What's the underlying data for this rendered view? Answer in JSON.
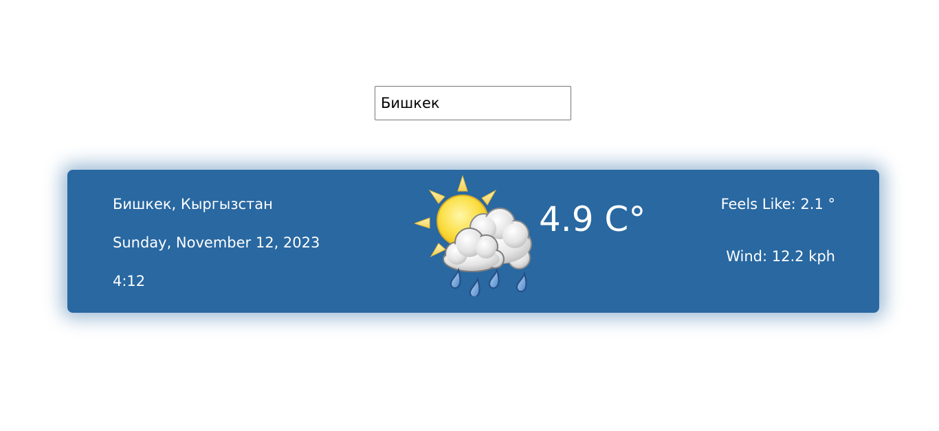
{
  "search": {
    "value": "Бишкек"
  },
  "weather": {
    "location": "Бишкек, Кыргызстан",
    "date": "Sunday, November 12, 2023",
    "time": "4:12",
    "temperature": "4.9 C°",
    "feels_like": "Feels Like: 2.1 °",
    "wind": "Wind: 12.2 kph",
    "condition_icon": "sun-cloud-rain-icon"
  },
  "colors": {
    "card_background": "#2968a1",
    "text": "#ffffff"
  }
}
